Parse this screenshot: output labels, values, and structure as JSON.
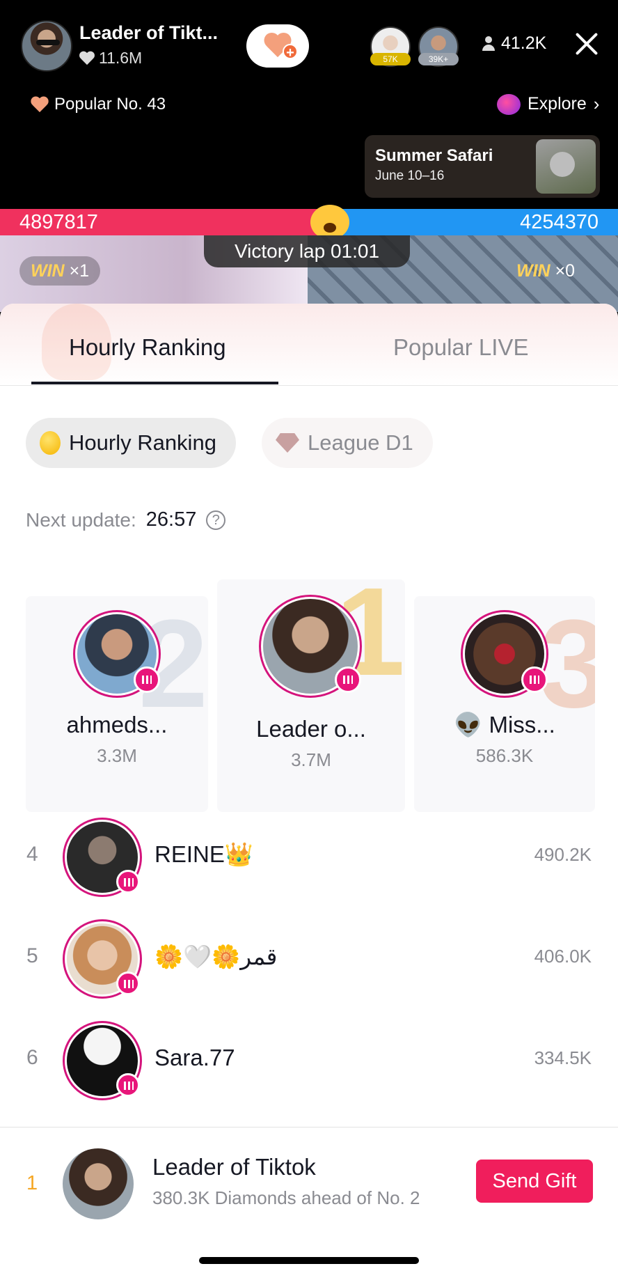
{
  "host": {
    "name": "Leader of Tikt...",
    "likes": "11.6M",
    "viewer_count": "41.2K",
    "viewer_badges": [
      "57K",
      "39K+"
    ]
  },
  "popular_tag": "Popular No. 43",
  "explore_label": "Explore",
  "event": {
    "title": "Summer Safari",
    "date": "June 10–16"
  },
  "battle": {
    "left_score": "4897817",
    "right_score": "4254370",
    "victory_label": "Victory lap  01:01",
    "left_win": "WIN",
    "left_win_count": "×1",
    "right_win": "WIN",
    "right_win_count": "×0"
  },
  "tabs": {
    "active": "Hourly Ranking",
    "inactive": "Popular LIVE"
  },
  "filters": {
    "hourly": "Hourly Ranking",
    "league": "League D1"
  },
  "next_update": {
    "label": "Next update:",
    "time": "26:57",
    "help": "?"
  },
  "podium": [
    {
      "rank": "2",
      "name": "ahmeds...",
      "score": "3.3M"
    },
    {
      "rank": "1",
      "name": "Leader o...",
      "score": "3.7M"
    },
    {
      "rank": "3",
      "name": "👽 Miss...",
      "score": "586.3K"
    }
  ],
  "list": [
    {
      "rank": "4",
      "name": "REINE👑",
      "score": "490.2K"
    },
    {
      "rank": "5",
      "name": "🌼🤍🌼قمر",
      "score": "406.0K"
    },
    {
      "rank": "6",
      "name": "Sara.77",
      "score": "334.5K"
    }
  ],
  "me": {
    "rank": "1",
    "name": "Leader of Tiktok",
    "sub": "380.3K Diamonds ahead of No. 2",
    "button": "Send Gift"
  },
  "colors": {
    "accent": "#f01e5c",
    "battle_red": "#f0315e",
    "battle_blue": "#2196f3",
    "live_ring": "#d4147c"
  }
}
